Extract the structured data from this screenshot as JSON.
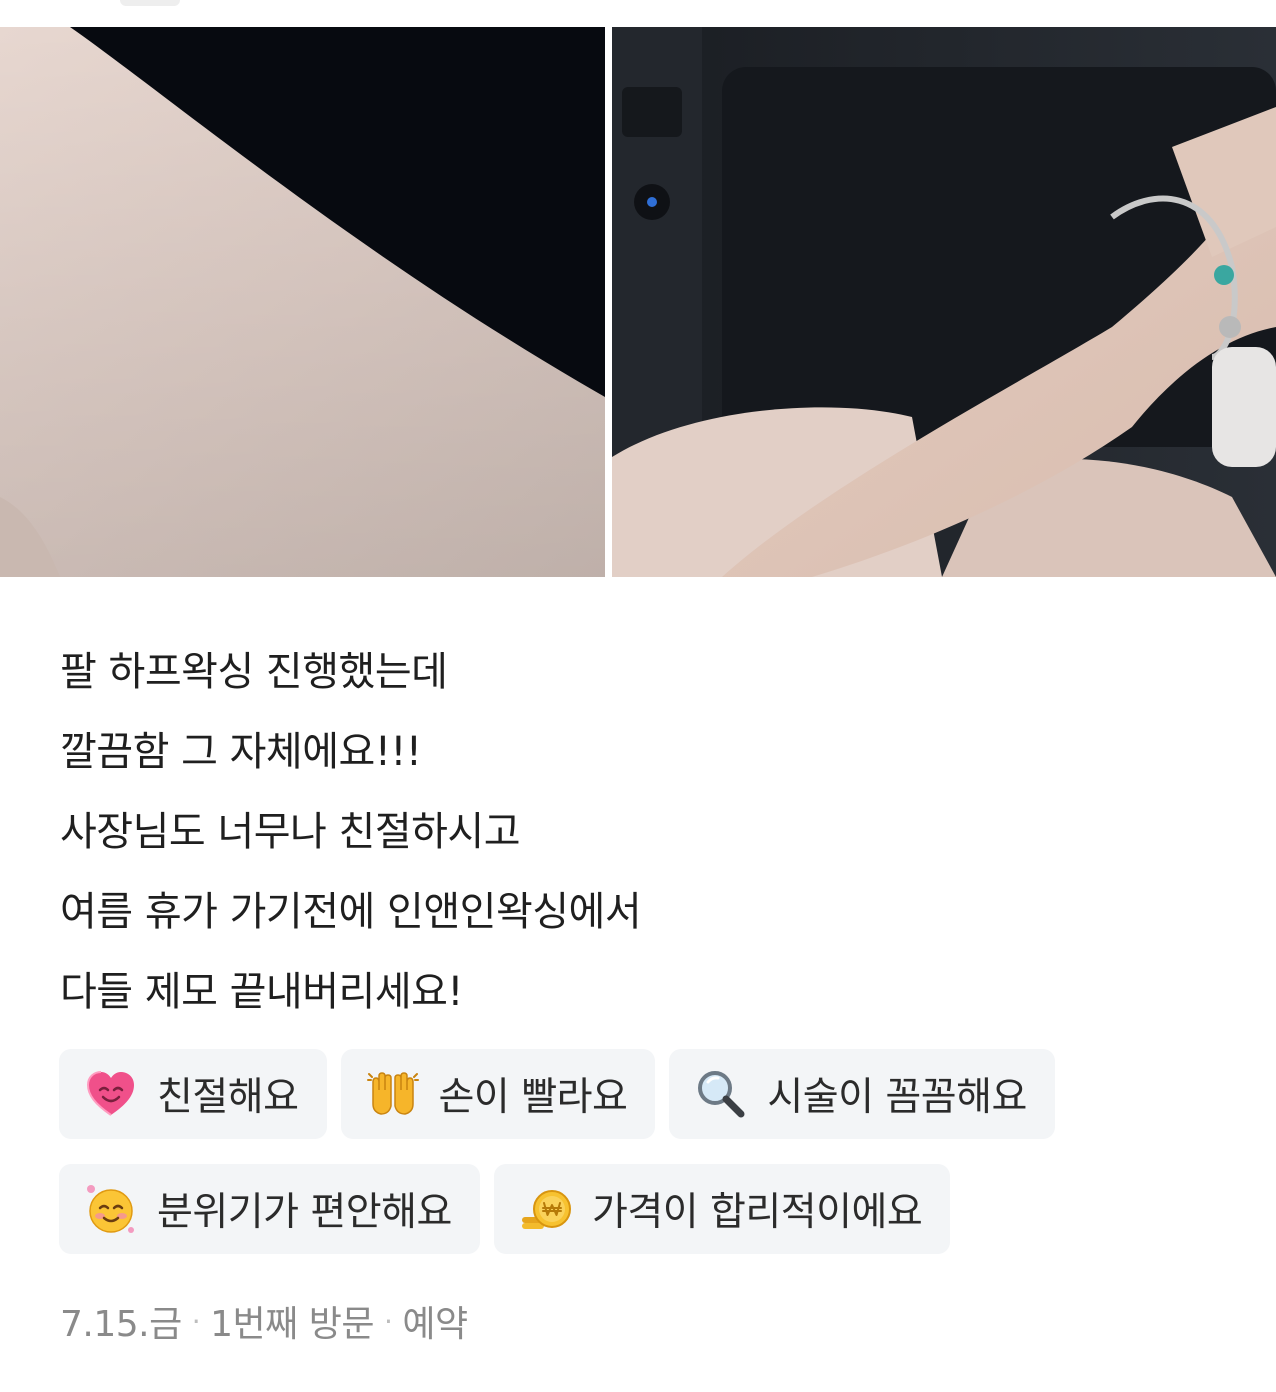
{
  "review": {
    "lines": [
      "팔 하프왁싱 진행했는데",
      "깔끔함 그 자체에요!!!",
      "사장님도 너무나 친절하시고",
      "여름 휴가 가기전에 인앤인왁싱에서",
      "다들 제모 끝내버리세요!"
    ]
  },
  "keywords": [
    {
      "icon": "smiling-heart-icon",
      "label": "친절해요"
    },
    {
      "icon": "raised-hands-icon",
      "label": "손이 빨라요"
    },
    {
      "icon": "magnifying-glass-icon",
      "label": "시술이 꼼꼼해요"
    },
    {
      "icon": "smiling-face-icon",
      "label": "분위기가 편안해요"
    },
    {
      "icon": "won-coin-icon",
      "label": "가격이 합리적이에요"
    }
  ],
  "meta": {
    "date": "7.15.금",
    "visit": "1번째 방문",
    "type": "예약"
  },
  "colors": {
    "chip_background": "#f3f5f7",
    "meta_text": "#8a8a8a"
  }
}
